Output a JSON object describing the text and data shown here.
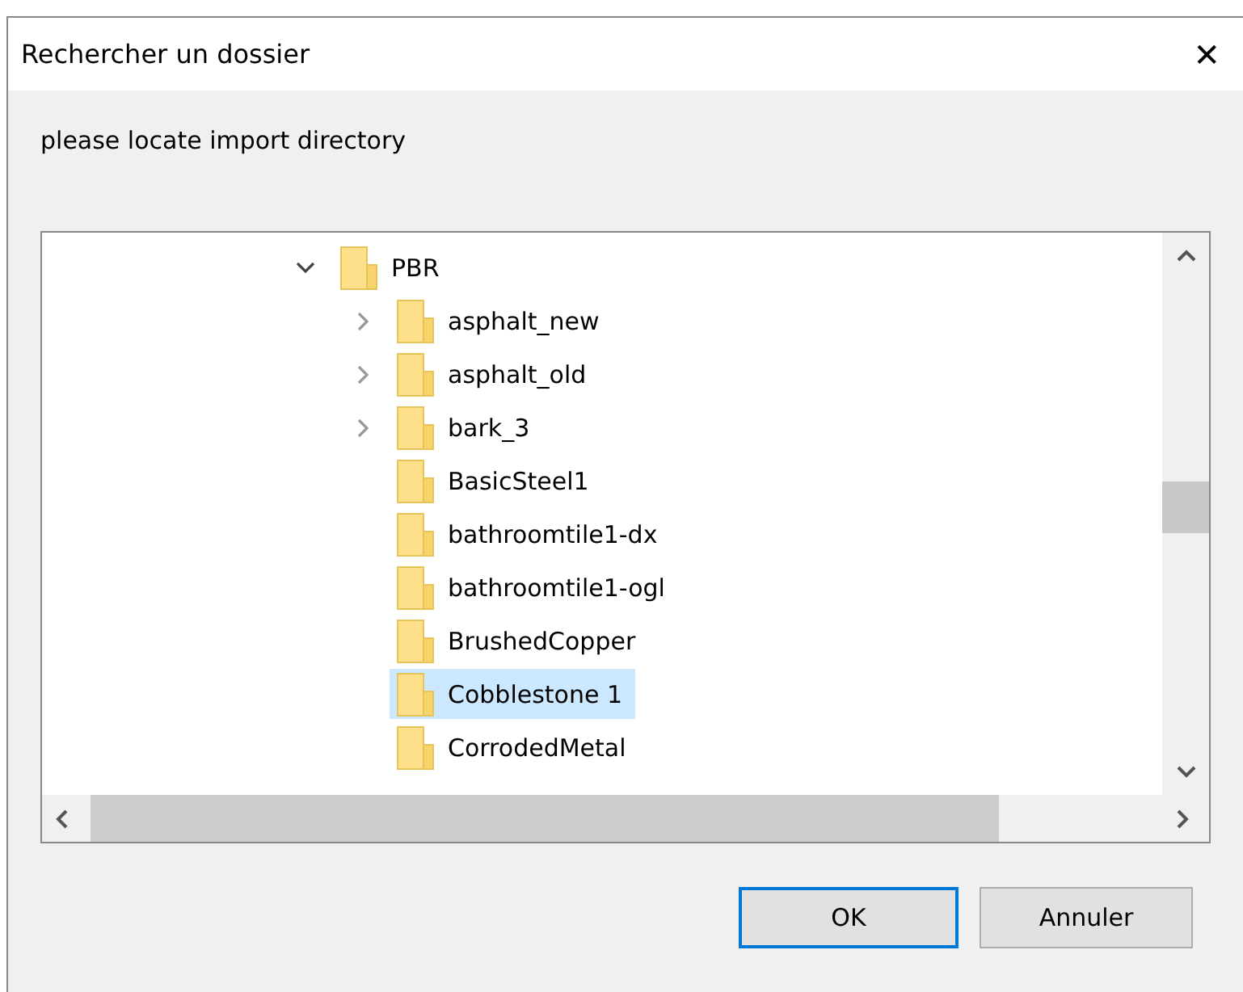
{
  "window": {
    "title": "Rechercher un dossier",
    "close": "✕"
  },
  "prompt": "please locate import directory",
  "tree": [
    {
      "label": "PBR",
      "expanded": true,
      "selected": false,
      "children": [
        {
          "label": "asphalt_new",
          "expanded": false,
          "selected": false
        },
        {
          "label": "asphalt_old",
          "expanded": false,
          "selected": false
        },
        {
          "label": "bark_3",
          "expanded": false,
          "selected": false
        },
        {
          "label": "BasicSteel1",
          "selected": false
        },
        {
          "label": "bathroomtile1-dx",
          "selected": false
        },
        {
          "label": "bathroomtile1-ogl",
          "selected": false
        },
        {
          "label": "BrushedCopper",
          "selected": false
        },
        {
          "label": "Cobblestone 1",
          "selected": true
        },
        {
          "label": "CorrodedMetal",
          "selected": false
        }
      ]
    }
  ],
  "buttons": [
    {
      "label": "OK",
      "default": true
    },
    {
      "label": "Annuler",
      "default": false
    }
  ]
}
